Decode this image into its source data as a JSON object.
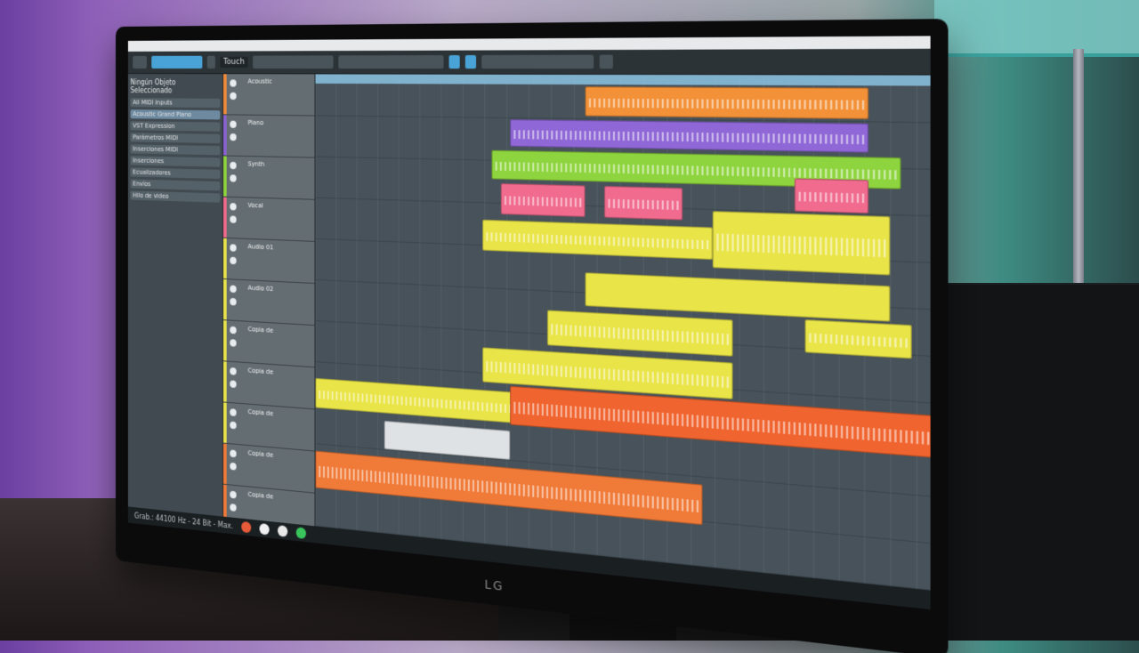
{
  "monitor": {
    "brand": "LG"
  },
  "daw": {
    "toolbar": {
      "mode_label": "Touch"
    },
    "inspector": {
      "title": "Ningún Objeto Seleccionado",
      "rows": [
        "All MIDI Inputs",
        "Acoustic Grand Piano",
        "VST Expression",
        "Parámetros MIDI",
        "Inserciones MIDI",
        "Inserciones",
        "Ecualizadores",
        "Envíos",
        "Hilo de video"
      ]
    },
    "tracks": [
      {
        "name": "Acoustic",
        "color": "#f08a3b"
      },
      {
        "name": "Piano",
        "color": "#8a63d2"
      },
      {
        "name": "Synth",
        "color": "#8ed43e"
      },
      {
        "name": "Vocal",
        "color": "#f06a8c"
      },
      {
        "name": "Audio 01",
        "color": "#e8e34a"
      },
      {
        "name": "Audio 02",
        "color": "#e8e34a"
      },
      {
        "name": "Copia de",
        "color": "#e8e34a"
      },
      {
        "name": "Copia de",
        "color": "#e8e34a"
      },
      {
        "name": "Copia de",
        "color": "#e8e34a"
      },
      {
        "name": "Copia de",
        "color": "#f07a38"
      },
      {
        "name": "Copia de",
        "color": "#f07a38"
      }
    ],
    "colors": {
      "orange": "#f39138",
      "purple": "#8f67d6",
      "green": "#8ed43e",
      "pink": "#f06b8e",
      "yellow": "#e9e448",
      "red_orange": "#f0642f",
      "white": "#dfe2e5"
    },
    "status": {
      "text": "Grab.: 44100 Hz - 24 Bit - Max."
    }
  }
}
